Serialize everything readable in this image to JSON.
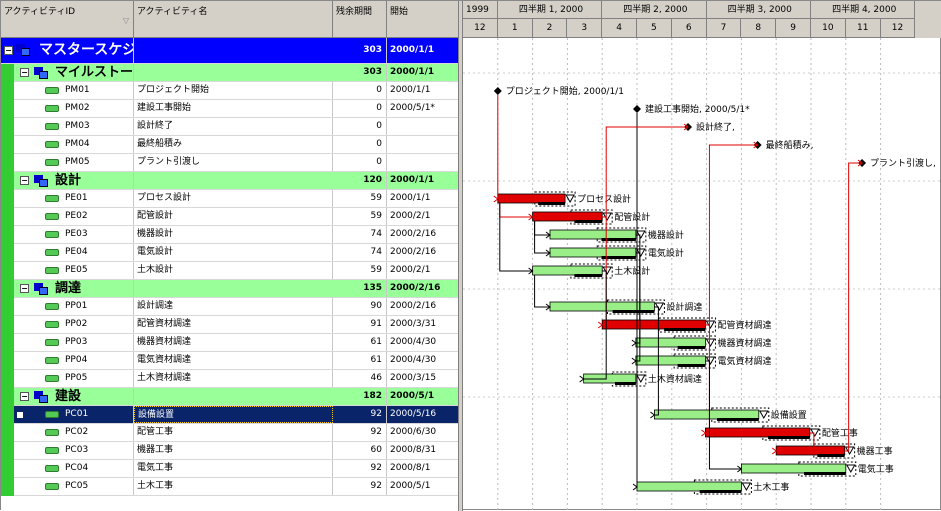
{
  "columns": {
    "id": "アクティビティID",
    "name": "アクティビティ名",
    "remaining": "残余期間",
    "start": "開始"
  },
  "timeline": {
    "top": [
      "1999",
      "四半期 1, 2000",
      "四半期 2, 2000",
      "四半期 3, 2000",
      "四半期 4, 2000"
    ],
    "months": [
      "12",
      "1",
      "2",
      "3",
      "4",
      "5",
      "6",
      "7",
      "8",
      "9",
      "10",
      "11",
      "12"
    ]
  },
  "project": {
    "name": "マスタースケジュール Reflection",
    "remaining": "303",
    "start": "2000/1/1"
  },
  "groups": [
    {
      "name": "マイルストーン",
      "remaining": "303",
      "start": "2000/1/1",
      "activities": [
        {
          "id": "PM01",
          "name": "プロジェクト開始",
          "remaining": "0",
          "start": "2000/1/1"
        },
        {
          "id": "PM02",
          "name": "建設工事開始",
          "remaining": "0",
          "start": "2000/5/1*"
        },
        {
          "id": "PM03",
          "name": "設計終了",
          "remaining": "0",
          "start": ""
        },
        {
          "id": "PM04",
          "name": "最終船積み",
          "remaining": "0",
          "start": ""
        },
        {
          "id": "PM05",
          "name": "プラント引渡し",
          "remaining": "0",
          "start": ""
        }
      ]
    },
    {
      "name": "設計",
      "remaining": "120",
      "start": "2000/1/1",
      "activities": [
        {
          "id": "PE01",
          "name": "プロセス設計",
          "remaining": "59",
          "start": "2000/1/1"
        },
        {
          "id": "PE02",
          "name": "配管設計",
          "remaining": "59",
          "start": "2000/2/1"
        },
        {
          "id": "PE03",
          "name": "機器設計",
          "remaining": "74",
          "start": "2000/2/16"
        },
        {
          "id": "PE04",
          "name": "電気設計",
          "remaining": "74",
          "start": "2000/2/16"
        },
        {
          "id": "PE05",
          "name": "土木設計",
          "remaining": "59",
          "start": "2000/2/1"
        }
      ]
    },
    {
      "name": "調達",
      "remaining": "135",
      "start": "2000/2/16",
      "activities": [
        {
          "id": "PP01",
          "name": "設計調達",
          "remaining": "90",
          "start": "2000/2/16"
        },
        {
          "id": "PP02",
          "name": "配管資材調達",
          "remaining": "91",
          "start": "2000/3/31"
        },
        {
          "id": "PP03",
          "name": "機器資材調達",
          "remaining": "61",
          "start": "2000/4/30"
        },
        {
          "id": "PP04",
          "name": "電気資材調達",
          "remaining": "61",
          "start": "2000/4/30"
        },
        {
          "id": "PP05",
          "name": "土木資材調達",
          "remaining": "46",
          "start": "2000/3/15"
        }
      ]
    },
    {
      "name": "建設",
      "remaining": "182",
      "start": "2000/5/1",
      "activities": [
        {
          "id": "PC01",
          "name": "設備設置",
          "remaining": "92",
          "start": "2000/5/16",
          "selected": true
        },
        {
          "id": "PC02",
          "name": "配管工事",
          "remaining": "92",
          "start": "2000/6/30"
        },
        {
          "id": "PC03",
          "name": "機器工事",
          "remaining": "60",
          "start": "2000/8/31"
        },
        {
          "id": "PC04",
          "name": "電気工事",
          "remaining": "92",
          "start": "2000/8/1"
        },
        {
          "id": "PC05",
          "name": "土木工事",
          "remaining": "92",
          "start": "2000/5/1"
        }
      ]
    }
  ],
  "gantt_labels": {
    "PM01": "プロジェクト開始, 2000/1/1",
    "PM02": "建設工事開始, 2000/5/1*",
    "PM03": "設計終了,",
    "PM04": "最終船積み,",
    "PM05": "プラント引渡し,",
    "PE01": "プロセス設計",
    "PE02": "配管設計",
    "PE03": "機器設計",
    "PE04": "電気設計",
    "PE05": "土木設計",
    "PP01": "設計調達",
    "PP02": "配管資材調達",
    "PP03": "機器資材調達",
    "PP04": "電気資材調達",
    "PP05": "土木資材調達",
    "PC01": "設備設置",
    "PC02": "配管工事",
    "PC03": "機器工事",
    "PC04": "電気工事",
    "PC05": "土木工事"
  },
  "bar_meta": {
    "critical": [
      "PE01",
      "PE02",
      "PP02",
      "PC02",
      "PC03"
    ],
    "durations_days": {
      "PE01": 59,
      "PE02": 59,
      "PE03": 74,
      "PE04": 74,
      "PE05": 59,
      "PP01": 90,
      "PP02": 91,
      "PP03": 61,
      "PP04": 61,
      "PP05": 46,
      "PC01": 92,
      "PC02": 92,
      "PC03": 60,
      "PC04": 92,
      "PC05": 92
    },
    "milestone_dates": {
      "PM01": "2000/1/1",
      "PM02": "2000/5/1",
      "PM03": "2000/6/15",
      "PM04": "2000/8/15",
      "PM05": "2000/11/15"
    }
  },
  "colors": {
    "critical": "#e00000",
    "normal": "#99ee88",
    "project": "#0000ff",
    "group": "#99ff99"
  }
}
